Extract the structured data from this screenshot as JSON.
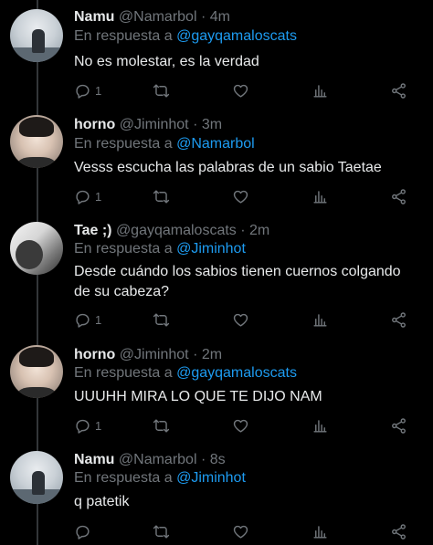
{
  "reply_prefix": "En respuesta a",
  "tweets": [
    {
      "name": "Namu",
      "handle": "@Namarbol",
      "sep": "·",
      "time": "4m",
      "reply_to": "@gayqamaloscats",
      "text": "No es molestar, es la verdad",
      "reply_count": "1"
    },
    {
      "name": "horno",
      "handle": "@Jiminhot",
      "sep": "·",
      "time": "3m",
      "reply_to": "@Namarbol",
      "text": "Vesss escucha las palabras de un sabio Taetae",
      "reply_count": "1"
    },
    {
      "name": "Tae ;)",
      "handle": "@gayqamaloscats",
      "sep": "·",
      "time": "2m",
      "reply_to": "@Jiminhot",
      "text": "Desde cuándo los sabios tienen cuernos colgando de su cabeza?",
      "reply_count": "1"
    },
    {
      "name": "horno",
      "handle": "@Jiminhot",
      "sep": "·",
      "time": "2m",
      "reply_to": "@gayqamaloscats",
      "text": "UUUHH MIRA LO QUE TE DIJO NAM",
      "reply_count": "1"
    },
    {
      "name": "Namu",
      "handle": "@Namarbol",
      "sep": "·",
      "time": "8s",
      "reply_to": "@Jiminhot",
      "text": "q patetik",
      "reply_count": ""
    }
  ],
  "icons": {
    "reply": "reply-icon",
    "retweet": "retweet-icon",
    "like": "heart-icon",
    "views": "views-icon",
    "share": "share-icon"
  },
  "colors": {
    "background": "#000000",
    "text": "#e7e9ea",
    "muted": "#71767b",
    "mention": "#1d9bf0",
    "thread_line": "#333639"
  }
}
